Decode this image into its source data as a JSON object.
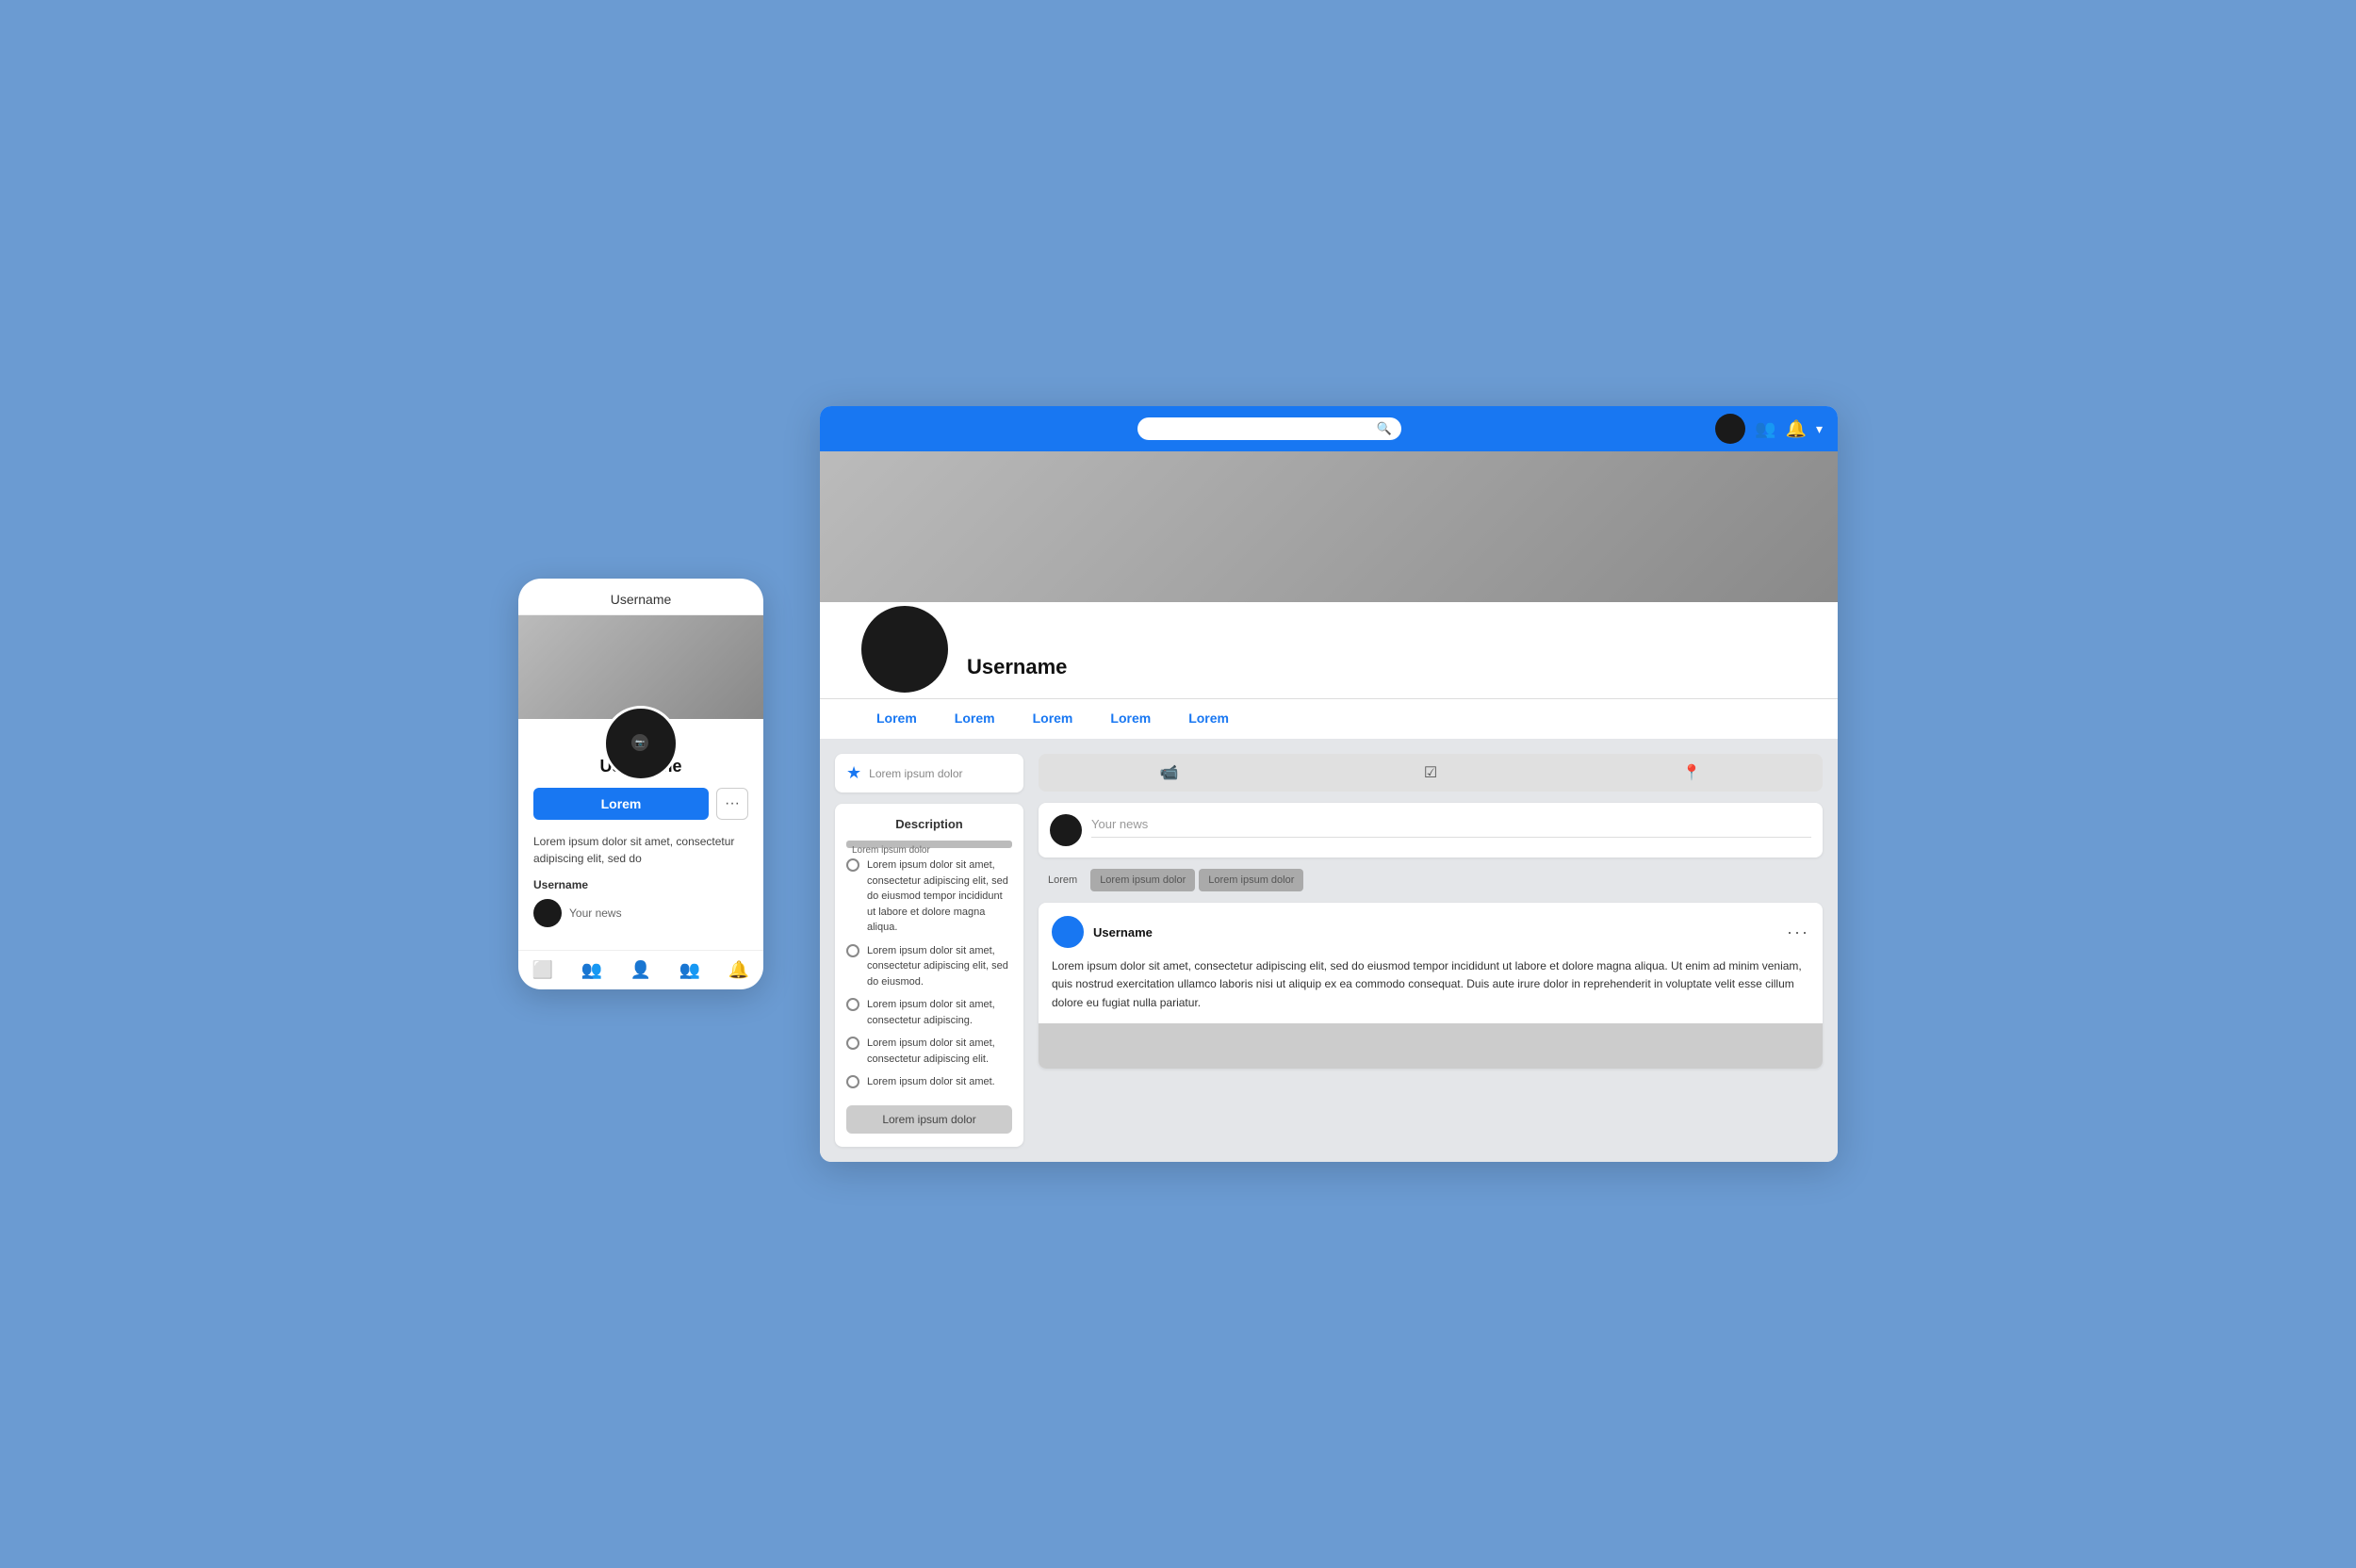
{
  "page": {
    "background": "#6b9bd2"
  },
  "mobile": {
    "title": "Username",
    "button_label": "Lorem",
    "bio": "Lorem ipsum dolor sit amet, consectetur adipiscing elit, sed do",
    "friend_label": "Username",
    "your_news": "Your news",
    "nav_items": [
      "home",
      "friends",
      "profile",
      "groups",
      "bell"
    ]
  },
  "desktop": {
    "search_placeholder": "",
    "topbar_icons": [
      "friends-icon",
      "bell-icon",
      "chevron-icon"
    ],
    "profile": {
      "name": "Username",
      "tabs": [
        "Lorem",
        "Lorem",
        "Lorem",
        "Lorem",
        "Lorem"
      ]
    },
    "news_input_placeholder": "Lorem ipsum dolor",
    "description": {
      "title": "Description",
      "bar_label": "Lorem ipsum dolor",
      "list_items": [
        "Lorem ipsum dolor sit amet, consectetur adipiscing elit, sed do eiusmod tempor incididunt ut labore et dolore magna aliqua.",
        "Lorem ipsum dolor sit amet, consectetur adipiscing elit, sed do eiusmod.",
        "Lorem ipsum dolor sit amet, consectetur adipiscing.",
        "Lorem ipsum dolor sit amet, consectetur adipiscing elit.",
        "Lorem ipsum dolor sit amet."
      ],
      "button_label": "Lorem ipsum dolor"
    },
    "post_section": {
      "your_news_placeholder": "Your news",
      "filter_tabs": [
        "Lorem",
        "Lorem ipsum dolor",
        "Lorem ipsum dolor"
      ],
      "post": {
        "username": "Username",
        "text": "Lorem ipsum dolor sit amet, consectetur adipiscing elit, sed do eiusmod tempor incididunt ut labore et dolore magna aliqua. Ut enim ad minim veniam, quis nostrud exercitation ullamco laboris nisi ut aliquip ex ea commodo consequat. Duis aute irure dolor in reprehenderit in voluptate velit esse cillum dolore eu fugiat nulla pariatur."
      }
    }
  }
}
